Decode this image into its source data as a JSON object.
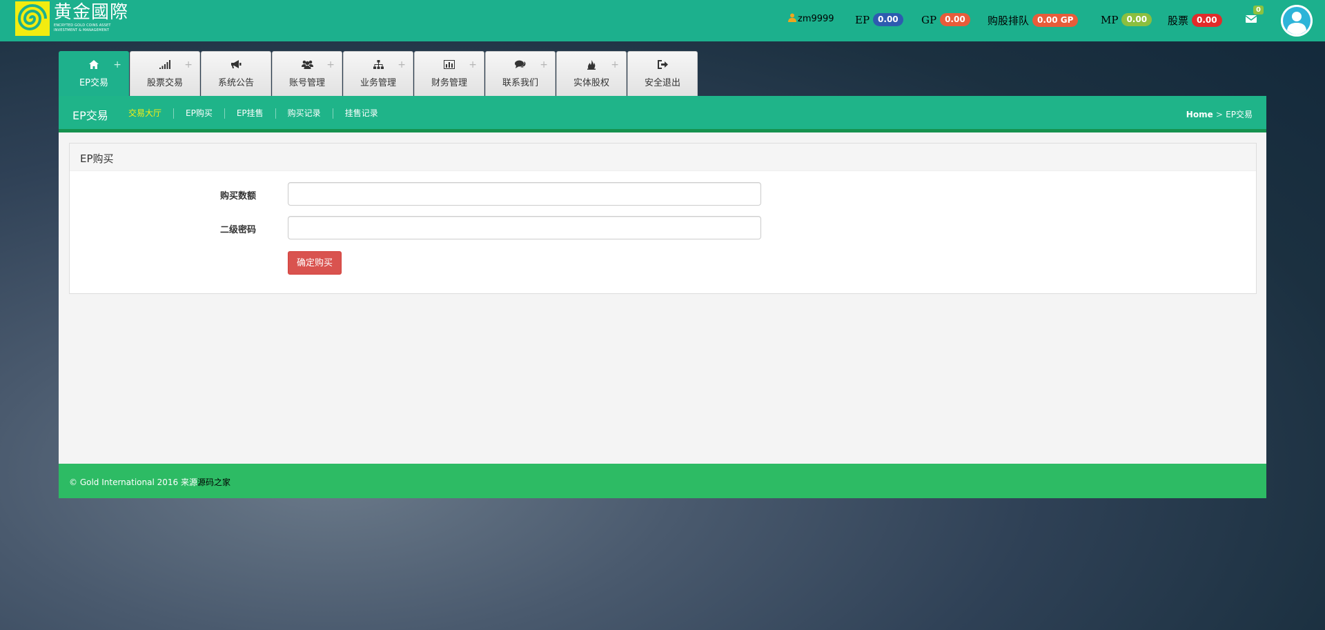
{
  "brand": {
    "name": "黄金國際",
    "tagline_line1": "ENCRYTED GOLD COINS ASSET",
    "tagline_line2": "INVESTMENT & MANAGEMENT"
  },
  "header": {
    "username": "zm9999",
    "stats": [
      {
        "label": "EP",
        "value": "0.00",
        "color": "#2d5bb0"
      },
      {
        "label": "GP",
        "value": "0.00",
        "color": "#e85c3a"
      },
      {
        "label": "购股排队",
        "value": "0.00 GP",
        "color": "#e85c3a"
      },
      {
        "label": "MP",
        "value": "0.00",
        "color": "#8cbf3f"
      },
      {
        "label": "股票",
        "value": "0.00",
        "color": "#e22a2a"
      }
    ],
    "mail_count": "0"
  },
  "tabs": [
    {
      "label": "EP交易",
      "icon": "home-icon",
      "active": true
    },
    {
      "label": "股票交易",
      "icon": "signal-icon",
      "active": false
    },
    {
      "label": "系统公告",
      "icon": "bullhorn-icon",
      "active": false
    },
    {
      "label": "账号管理",
      "icon": "users-icon",
      "active": false
    },
    {
      "label": "业务管理",
      "icon": "sitemap-icon",
      "active": false
    },
    {
      "label": "财务管理",
      "icon": "bar-chart-icon",
      "active": false
    },
    {
      "label": "联系我们",
      "icon": "comments-icon",
      "active": false
    },
    {
      "label": "实体股权",
      "icon": "fire-icon",
      "active": false
    },
    {
      "label": "安全退出",
      "icon": "sign-out-icon",
      "active": false
    }
  ],
  "tab_plus": "+",
  "subnav": {
    "title": "EP交易",
    "links": [
      {
        "label": "交易大厅",
        "active": true
      },
      {
        "label": "EP购买",
        "active": false
      },
      {
        "label": "EP挂售",
        "active": false
      },
      {
        "label": "购买记录",
        "active": false
      },
      {
        "label": "挂售记录",
        "active": false
      }
    ],
    "breadcrumb": {
      "home": "Home",
      "separator": ">",
      "current": "EP交易"
    }
  },
  "form": {
    "heading": "EP购买",
    "amount_label": "购买数额",
    "amount_value": "",
    "password_label": "二级密码",
    "password_value": "",
    "submit_label": "确定购买"
  },
  "footer": {
    "copyright": "© Gold International 2016 来源",
    "source_link": "源码之家"
  }
}
